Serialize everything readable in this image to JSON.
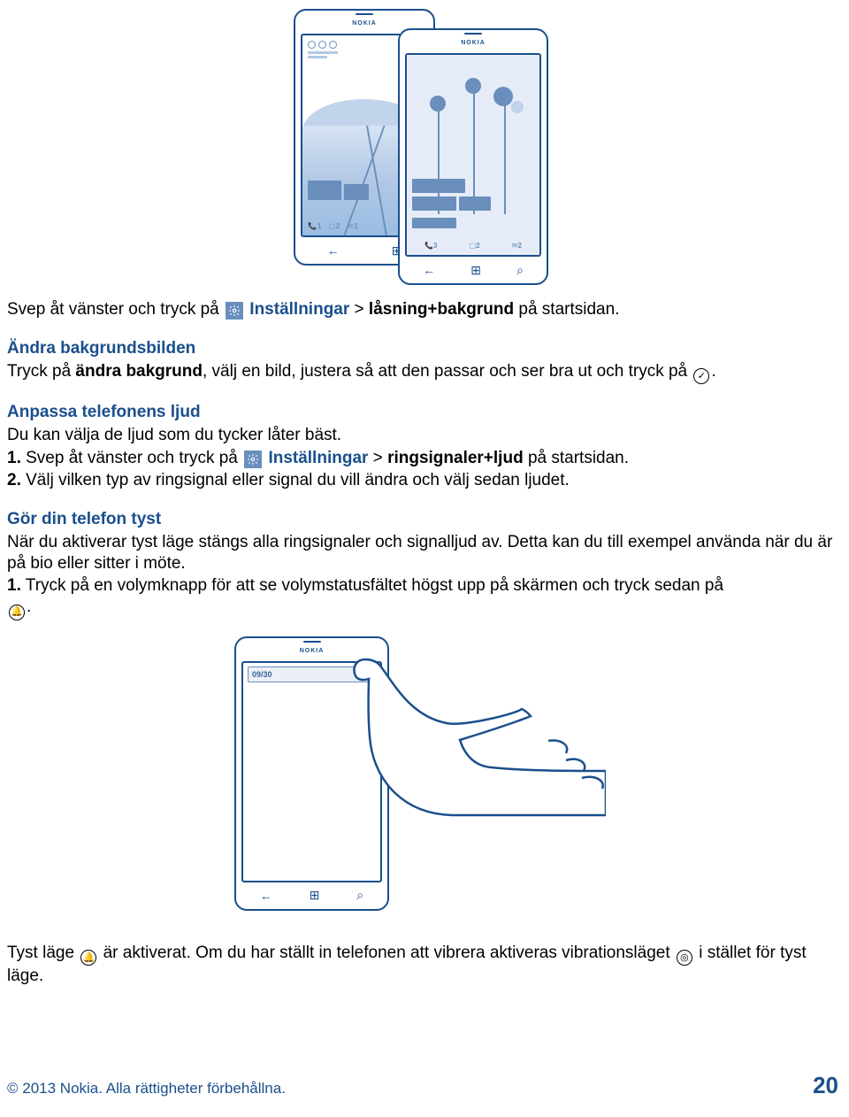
{
  "illustration_top": {
    "phone_brand": "NOKIA",
    "phone_a": {
      "badge1": "1",
      "badge2": "2",
      "badge3": "1"
    },
    "phone_b": {
      "badge1": "3",
      "badge2": "2",
      "badge3": "2"
    },
    "nav_back": "←",
    "nav_win": "⊞",
    "nav_search": "⌕"
  },
  "p1": {
    "prefix": "Svep åt vänster och tryck på ",
    "settings_label": "Inställningar",
    "separator": " > ",
    "item": "låsning+bakgrund",
    "suffix": " på startsidan."
  },
  "p2": {
    "heading": "Ändra bakgrundsbilden",
    "line_a": "Tryck på ",
    "link": "ändra bakgrund",
    "line_b": ", välj en bild, justera så att den passar och ser bra ut och tryck på ",
    "period": "."
  },
  "p3": {
    "heading": "Anpassa telefonens ljud",
    "line": "Du kan välja de ljud som du tycker låter bäst.",
    "step1_num": "1.",
    "step1_a": " Svep åt vänster och tryck på ",
    "step1_settings": "Inställningar",
    "step1_sep": " > ",
    "step1_item": "ringsignaler+ljud",
    "step1_b": " på startsidan.",
    "step2_num": "2.",
    "step2": " Välj vilken typ av ringsignal eller signal du vill ändra och välj sedan ljudet."
  },
  "p4": {
    "heading": "Gör din telefon tyst",
    "line1": "När du aktiverar tyst läge stängs alla ringsignaler och signalljud av. Detta kan du till exempel använda när du är på bio eller sitter i möte.",
    "step1_num": "1.",
    "step1": " Tryck på en volymknapp för att se volymstatusfältet högst upp på skärmen och tryck sedan på ",
    "period": "."
  },
  "illustration_bottom": {
    "phone_brand": "NOKIA",
    "volume_text": "09/30"
  },
  "p5": {
    "a": "Tyst läge ",
    "b": " är aktiverat. Om du har ställt in telefonen att vibrera aktiveras vibrationsläget ",
    "c": " i stället för tyst läge."
  },
  "footer": {
    "copyright": "© 2013 Nokia. Alla rättigheter förbehållna.",
    "page": "20"
  },
  "icons": {
    "check": "✓",
    "bell": "🔔",
    "vibrate": "◎"
  }
}
